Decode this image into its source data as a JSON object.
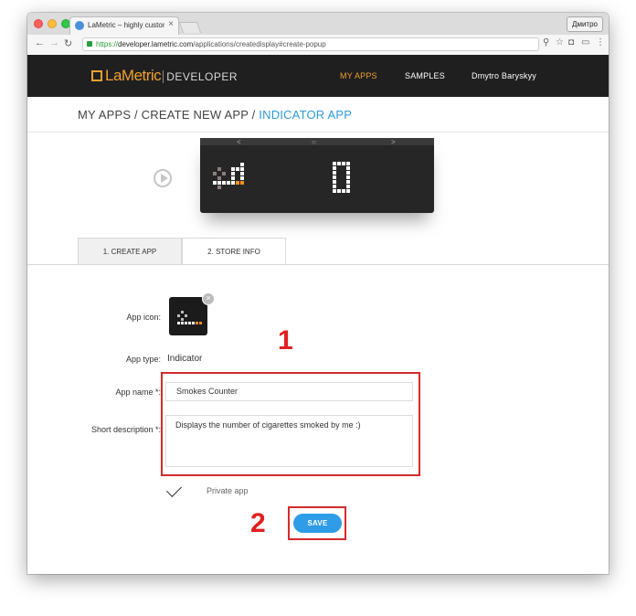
{
  "browser": {
    "tab_title": "LaMetric – highly customizable",
    "tab_close": "×",
    "user_button": "Дмитро",
    "url_scheme": "https://",
    "url_host": "developer.lametric.com",
    "url_path": "/applications/createdisplay#create-popup",
    "icons": [
      "back-arrow-icon",
      "forward-arrow-icon",
      "reload-icon",
      "lock-icon",
      "key-icon",
      "star-icon",
      "extension-icon",
      "pocket-icon",
      "cast-icon",
      "menu-icon"
    ]
  },
  "site": {
    "logo_text": "LaMetric",
    "logo_sub": "DEVELOPER",
    "nav": [
      {
        "label": "MY APPS",
        "active": true
      },
      {
        "label": "SAMPLES",
        "active": false
      },
      {
        "label": "Dmytro Baryskyy",
        "active": false
      }
    ],
    "accent_color": "#f0a030",
    "link_color": "#2f9ad8"
  },
  "breadcrumb": {
    "part1": "MY APPS / CREATE NEW APP / ",
    "current": "INDICATOR APP"
  },
  "device": {
    "display_digit": "0",
    "buttons": [
      "<",
      "○",
      ">"
    ]
  },
  "tabs": [
    {
      "label": "1. CREATE APP",
      "active": false
    },
    {
      "label": "2. STORE INFO",
      "active": true
    }
  ],
  "form": {
    "app_icon_label": "App icon:",
    "app_type_label": "App type:",
    "app_type_value": "Indicator",
    "app_name_label": "App name *:",
    "app_name_value": "Smokes Counter",
    "short_desc_label": "Short description *:",
    "short_desc_value": "Displays the number of cigarettes smoked by me :)",
    "private_label": "Private app",
    "private_checked": true,
    "save_label": "SAVE",
    "remove_icon_glyph": "×"
  },
  "annotations": {
    "marker1": "1",
    "marker2": "2",
    "color": "#d62a2a"
  }
}
